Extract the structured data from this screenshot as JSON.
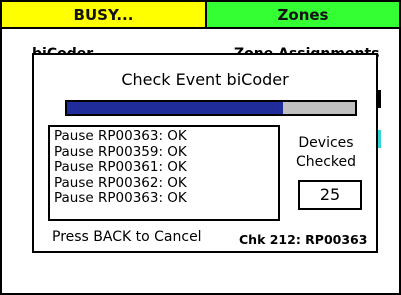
{
  "tabs": {
    "busy_label": "BUSY...",
    "zones_label": "Zones"
  },
  "background": {
    "left_label": "biCoder",
    "right_label": "Zone Assignments"
  },
  "dialog": {
    "title": "Check Event biCoder",
    "progress": 0.75,
    "log_lines": [
      "Pause RP00363: OK",
      "Pause RP00359: OK",
      "Pause RP00361: OK",
      "Pause RP00362: OK",
      "Pause RP00363: OK"
    ],
    "devices_label_line1": "Devices",
    "devices_label_line2": "Checked",
    "devices_checked": "25",
    "cancel_hint": "Press BACK to Cancel",
    "status": "Chk 212: RP00363"
  },
  "colors": {
    "busy_tab": "#ffff00",
    "zones_tab": "#33ff33",
    "progress_fill": "#1f2c9a",
    "progress_track": "#c0c0c0"
  }
}
